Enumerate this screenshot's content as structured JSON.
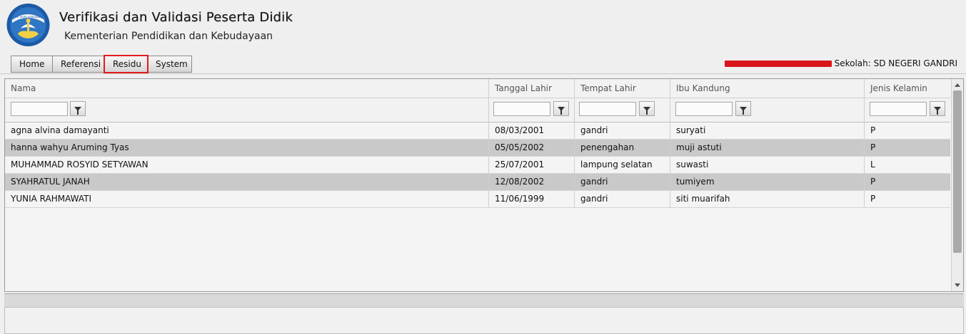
{
  "app": {
    "title": "Verifikasi dan Validasi Peserta Didik",
    "subtitle": "Kementerian Pendidikan dan Kebudayaan",
    "logo_icon": "tut-wuri-handayani-logo",
    "logo_text": "TUT WURI HANDAYANI"
  },
  "nav": [
    {
      "label": "Home",
      "active": false
    },
    {
      "label": "Referensi",
      "active": false
    },
    {
      "label": "Residu",
      "active": true
    },
    {
      "label": "System",
      "active": false
    }
  ],
  "user": {
    "sekolah_label": "Sekolah: SD NEGERI GANDRI"
  },
  "table": {
    "columns": [
      "Nama",
      "Tanggal Lahir",
      "Tempat Lahir",
      "Ibu Kandung",
      "Jenis Kelamin"
    ],
    "filter_icon": "filter-icon",
    "rows": [
      [
        "agna alvina damayanti",
        "08/03/2001",
        "gandri",
        "suryati",
        "P"
      ],
      [
        "hanna wahyu Aruming Tyas",
        "05/05/2002",
        "penengahan",
        "muji astuti",
        "P"
      ],
      [
        "MUHAMMAD ROSYID SETYAWAN",
        "25/07/2001",
        "lampung selatan",
        "suwasti",
        "L"
      ],
      [
        "SYAHRATUL JANAH",
        "12/08/2002",
        "gandri",
        "tumiyem",
        "P"
      ],
      [
        "YUNIA RAHMAWATI",
        "11/06/1999",
        "gandri",
        "siti muarifah",
        "P"
      ]
    ]
  },
  "colors": {
    "highlight": "#e31b1b",
    "row_alt": "#c9c9c9",
    "redaction": "#d8161b"
  }
}
